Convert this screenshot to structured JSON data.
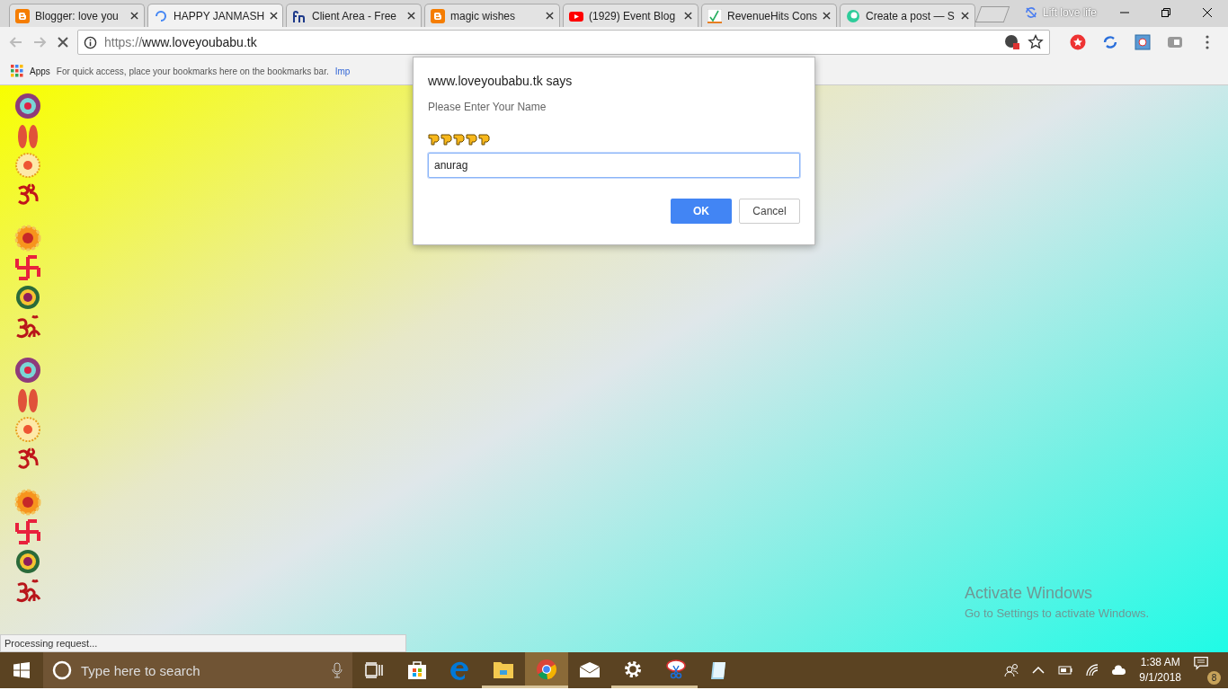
{
  "browser": {
    "tabs": [
      {
        "title": "Blogger: love you",
        "kind": "blogger",
        "selected": false
      },
      {
        "title": "HAPPY JANMASH",
        "kind": "loading",
        "selected": true
      },
      {
        "title": "Client Area - Free",
        "kind": "fn",
        "selected": false
      },
      {
        "title": "magic wishes",
        "kind": "blogger",
        "selected": false
      },
      {
        "title": "(1929) Event Blog",
        "kind": "youtube",
        "selected": false
      },
      {
        "title": "RevenueHits Cons",
        "kind": "check",
        "selected": false
      },
      {
        "title": "Create a post — S",
        "kind": "swirl",
        "selected": false
      }
    ],
    "profile_name": "Lift love life",
    "address": {
      "scheme": "https://",
      "host": "www.loveyoubabu.tk"
    },
    "bookmarks": {
      "apps": "Apps",
      "hint": "For quick access, place your bookmarks here on the bookmarks bar.",
      "link": "Imp"
    },
    "status": "Processing request..."
  },
  "dialog": {
    "title": "www.loveyoubabu.tk says",
    "message": "Please Enter Your Name",
    "value": "anurag",
    "ok": "OK",
    "cancel": "Cancel"
  },
  "activation": {
    "title": "Activate Windows",
    "hint": "Go to Settings to activate Windows."
  },
  "taskbar": {
    "search_placeholder": "Type here to search",
    "apps": [
      {
        "kind": "store",
        "running": false,
        "selected": false
      },
      {
        "kind": "edge",
        "running": false,
        "selected": false
      },
      {
        "kind": "folder",
        "running": true,
        "selected": false
      },
      {
        "kind": "chrome",
        "running": true,
        "selected": true
      },
      {
        "kind": "mail",
        "running": false,
        "selected": false
      },
      {
        "kind": "gear",
        "running": true,
        "selected": false
      },
      {
        "kind": "snip",
        "running": true,
        "selected": false
      },
      {
        "kind": "notepad",
        "running": false,
        "selected": false
      }
    ],
    "time": "1:38 AM",
    "date": "9/1/2018",
    "notifications": "8"
  }
}
